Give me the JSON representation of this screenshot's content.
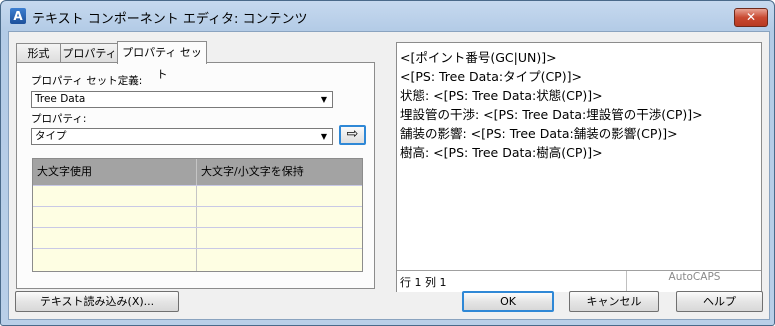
{
  "window": {
    "title": "テキスト コンポーネント エディタ: コンテンツ",
    "close_glyph": "✕",
    "app_icon_letter": "A"
  },
  "tabs": [
    {
      "label": "形式",
      "active": false
    },
    {
      "label": "プロパティ",
      "active": false
    },
    {
      "label": "プロパティ セット",
      "active": true
    }
  ],
  "property_set": {
    "definition_label": "プロパティ セット定義:",
    "definition_value": "Tree Data",
    "property_label": "プロパティ:",
    "property_value": "タイプ",
    "insert_icon": "arrow-right-icon",
    "insert_glyph": "⇨"
  },
  "grid": {
    "columns": [
      "大文字使用",
      "大文字/小文字を保持"
    ],
    "rows": [
      [
        "",
        ""
      ],
      [
        "",
        ""
      ],
      [
        "",
        ""
      ],
      [
        "",
        ""
      ]
    ]
  },
  "editor": {
    "lines": [
      "<[ポイント番号(GC|UN)]>",
      "<[PS: Tree  Data:タイプ(CP)]>",
      "状態: <[PS: Tree  Data:状態(CP)]>",
      "埋設管の干渉: <[PS: Tree  Data:埋設管の干渉(CP)]>",
      "舗装の影響: <[PS: Tree  Data:舗装の影響(CP)]>",
      "樹高: <[PS: Tree  Data:樹高(CP)]>"
    ],
    "status_position": "行 1 列 1",
    "status_caps": "AutoCAPS"
  },
  "buttons": {
    "import": "テキスト読み込み(X)...",
    "ok": "OK",
    "cancel": "キャンセル",
    "help": "ヘルプ"
  },
  "colors": {
    "focus_accent": "#2f88d6",
    "grid_background": "#fefee3",
    "grid_header": "#a3a3a3"
  }
}
